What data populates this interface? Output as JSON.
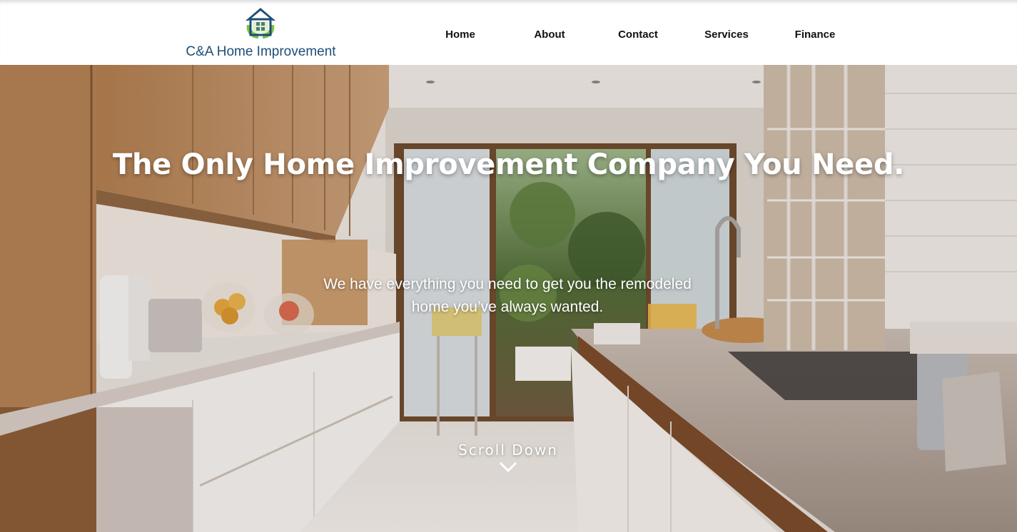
{
  "header": {
    "logo_text": "C&A Home Improvement",
    "nav": [
      {
        "label": "Home"
      },
      {
        "label": "About"
      },
      {
        "label": "Contact"
      },
      {
        "label": "Services"
      },
      {
        "label": "Finance"
      }
    ]
  },
  "hero": {
    "headline": "The Only Home Improvement Company You Need.",
    "subline": "We have everything you need to get you the remodeled home you’ve always wanted.",
    "scroll_label": "Scroll Down",
    "background_image": "kitchen-photo",
    "scroll_icon": "chevron-down-icon"
  },
  "colors": {
    "logo_text": "#1c4e78",
    "logo_green": "#7dc242",
    "nav_text": "#111111",
    "hero_text": "#ffffff"
  }
}
